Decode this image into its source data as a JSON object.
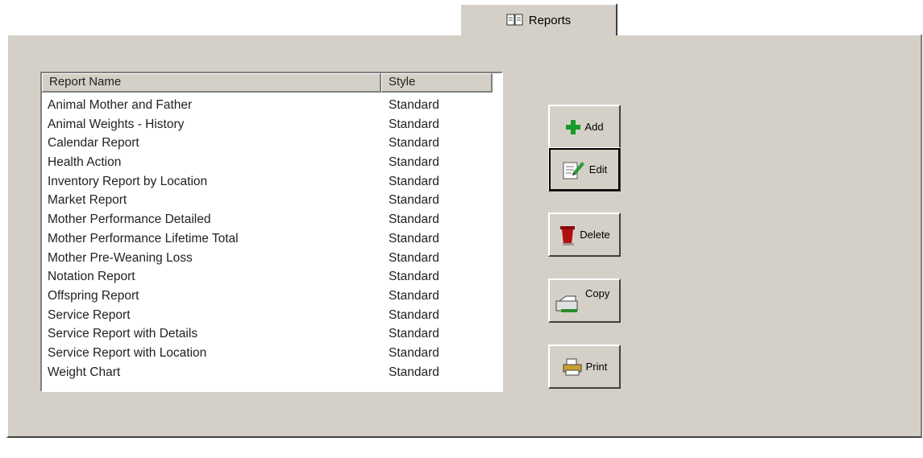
{
  "tab": {
    "label": "Reports",
    "icon": "book-icon"
  },
  "table": {
    "columns": [
      "Report Name",
      "Style"
    ],
    "rows": [
      [
        "Animal Mother and Father",
        "Standard"
      ],
      [
        "Animal Weights - History",
        "Standard"
      ],
      [
        "Calendar Report",
        "Standard"
      ],
      [
        "Health Action",
        "Standard"
      ],
      [
        "Inventory Report by Location",
        "Standard"
      ],
      [
        "Market Report",
        "Standard"
      ],
      [
        "Mother Performance Detailed",
        "Standard"
      ],
      [
        "Mother Performance Lifetime Total",
        "Standard"
      ],
      [
        "Mother Pre-Weaning Loss",
        "Standard"
      ],
      [
        "Notation Report",
        "Standard"
      ],
      [
        "Offspring Report",
        "Standard"
      ],
      [
        "Service Report",
        "Standard"
      ],
      [
        "Service Report with Details",
        "Standard"
      ],
      [
        "Service Report with Location",
        "Standard"
      ],
      [
        "Weight Chart",
        "Standard"
      ]
    ]
  },
  "buttons": {
    "add": "Add",
    "edit": "Edit",
    "delete": "Delete",
    "copy": "Copy",
    "print": "Print"
  },
  "colors": {
    "add_plus": "#1a9a2a",
    "delete_can": "#b01010",
    "face": "#d4d0c8"
  }
}
